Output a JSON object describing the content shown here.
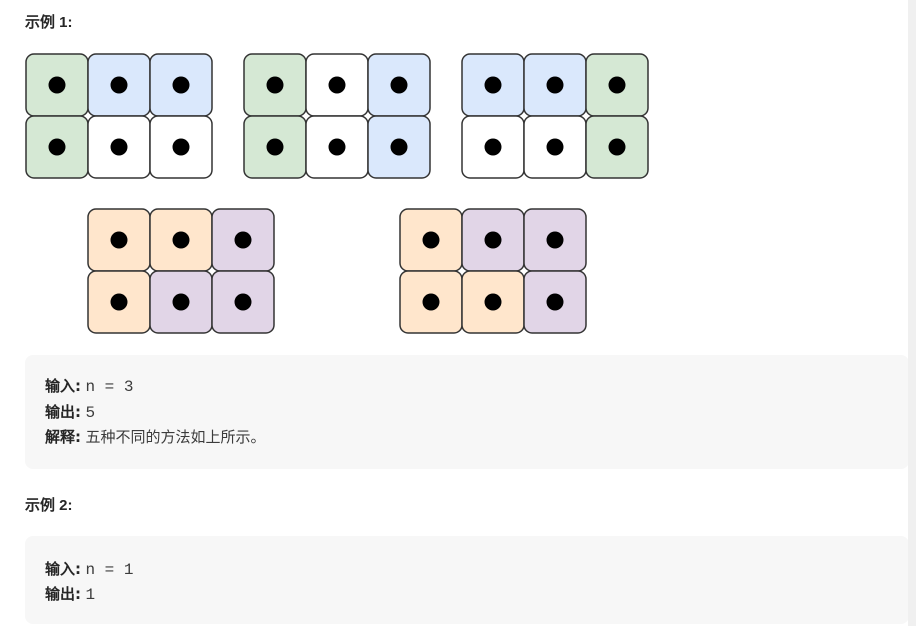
{
  "colors": {
    "green": "#d5e8d4",
    "blue": "#dae8fc",
    "white": "#ffffff",
    "orange": "#ffe6cc",
    "purple": "#e1d5e7",
    "stroke": "#333333",
    "dot": "#000000"
  },
  "example1": {
    "heading": "示例 1:",
    "input_label": "输入:",
    "input_value": "n = 3",
    "output_label": "输出:",
    "output_value": "5",
    "explain_label": "解释:",
    "explain_value": "五种不同的方法如上所示。"
  },
  "example2": {
    "heading": "示例 2:",
    "input_label": "输入:",
    "input_value": "n = 1",
    "output_label": "输出:",
    "output_value": "1"
  },
  "tilings": [
    {
      "name": "tiling-1",
      "tiles": [
        [
          "green",
          "green"
        ],
        [
          "blue",
          "white"
        ],
        [
          "blue",
          "white"
        ]
      ]
    },
    {
      "name": "tiling-2",
      "tiles": [
        [
          "green",
          "green"
        ],
        [
          "white",
          "white"
        ],
        [
          "blue",
          "blue"
        ]
      ]
    },
    {
      "name": "tiling-3",
      "tiles": [
        [
          "blue",
          "white"
        ],
        [
          "blue",
          "white"
        ],
        [
          "green",
          "green"
        ]
      ]
    },
    {
      "name": "tiling-4",
      "tiles": [
        [
          "orange",
          "orange"
        ],
        [
          "orange",
          "purple"
        ],
        [
          "purple",
          "purple"
        ]
      ]
    },
    {
      "name": "tiling-5",
      "tiles": [
        [
          "orange",
          "orange"
        ],
        [
          "purple",
          "orange"
        ],
        [
          "purple",
          "purple"
        ]
      ]
    }
  ]
}
